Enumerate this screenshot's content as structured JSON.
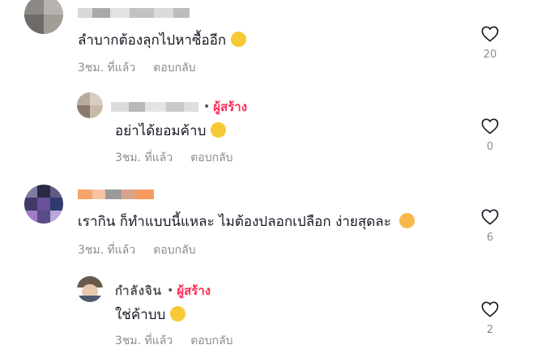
{
  "comments": [
    {
      "text": "ลำบากต้องลุกไปหาซื้ออีก",
      "emoji": "laughing-tears-emoji",
      "time": "3ชม. ที่แล้ว",
      "reply": "ตอบกลับ",
      "likes": "20"
    },
    {
      "creator_label": "ผู้สร้าง",
      "text": "อย่าได้ยอมค้าบ",
      "emoji": "laughing-tears-emoji",
      "time": "3ชม. ที่แล้ว",
      "reply": "ตอบกลับ",
      "likes": "0"
    },
    {
      "text": "เรากิน ก็ทำแบบนี้แหละ ไมต้องปลอกเปลือก ง่ายสุดละ",
      "emoji": "smiling-hearts-emoji",
      "time": "3ชม. ที่แล้ว",
      "reply": "ตอบกลับ",
      "likes": "6"
    },
    {
      "username": "กำลังจิน",
      "creator_label": "ผู้สร้าง",
      "text": "ใช่ค้าบบ",
      "emoji": "flushed-emoji",
      "time": "3ชม. ที่แล้ว",
      "reply": "ตอบกลับ",
      "likes": "2"
    }
  ],
  "colors": {
    "creator": "#fe2c55",
    "meta": "#8a8b91",
    "text": "#161823"
  }
}
